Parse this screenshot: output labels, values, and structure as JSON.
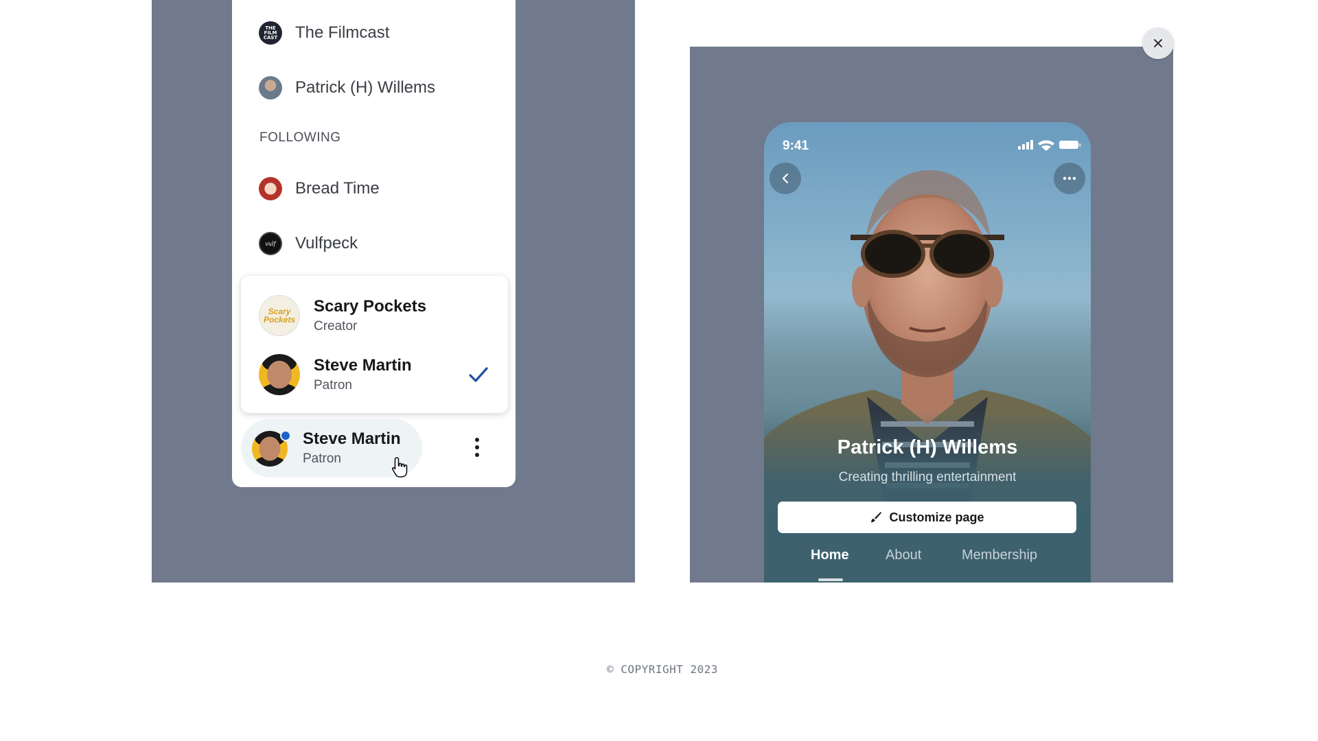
{
  "sidebar": {
    "supporting": [
      {
        "label": "The Filmcast",
        "avatar_text": "THE FILM CAST",
        "icon": "filmcast-avatar"
      },
      {
        "label": "Patrick (H) Willems",
        "icon": "patrick-avatar"
      }
    ],
    "following_label": "FOLLOWING",
    "following": [
      {
        "label": "Bread Time",
        "icon": "bread-time-avatar"
      },
      {
        "label": "Vulfpeck",
        "avatar_text": "vulf",
        "icon": "vulfpeck-avatar"
      }
    ]
  },
  "account_switcher": {
    "accounts": [
      {
        "name": "Scary Pockets",
        "role": "Creator",
        "avatar_text": "Scary Pockets",
        "selected": false
      },
      {
        "name": "Steve Martin",
        "role": "Patron",
        "selected": true
      }
    ]
  },
  "current_user": {
    "name": "Steve Martin",
    "role": "Patron",
    "has_notification": true
  },
  "phone_preview": {
    "status_time": "9:41",
    "creator_name": "Patrick (H) Willems",
    "tagline": "Creating thrilling entertainment",
    "customize_label": "Customize page",
    "tabs": [
      {
        "label": "Home",
        "active": true
      },
      {
        "label": "About",
        "active": false
      },
      {
        "label": "Membership",
        "active": false
      }
    ]
  },
  "footer": {
    "copyright": "© COPYRIGHT 2023"
  },
  "colors": {
    "panel_bg": "#717a8c",
    "accent_check": "#1f4fa0",
    "notification_dot": "#1f63c9"
  }
}
